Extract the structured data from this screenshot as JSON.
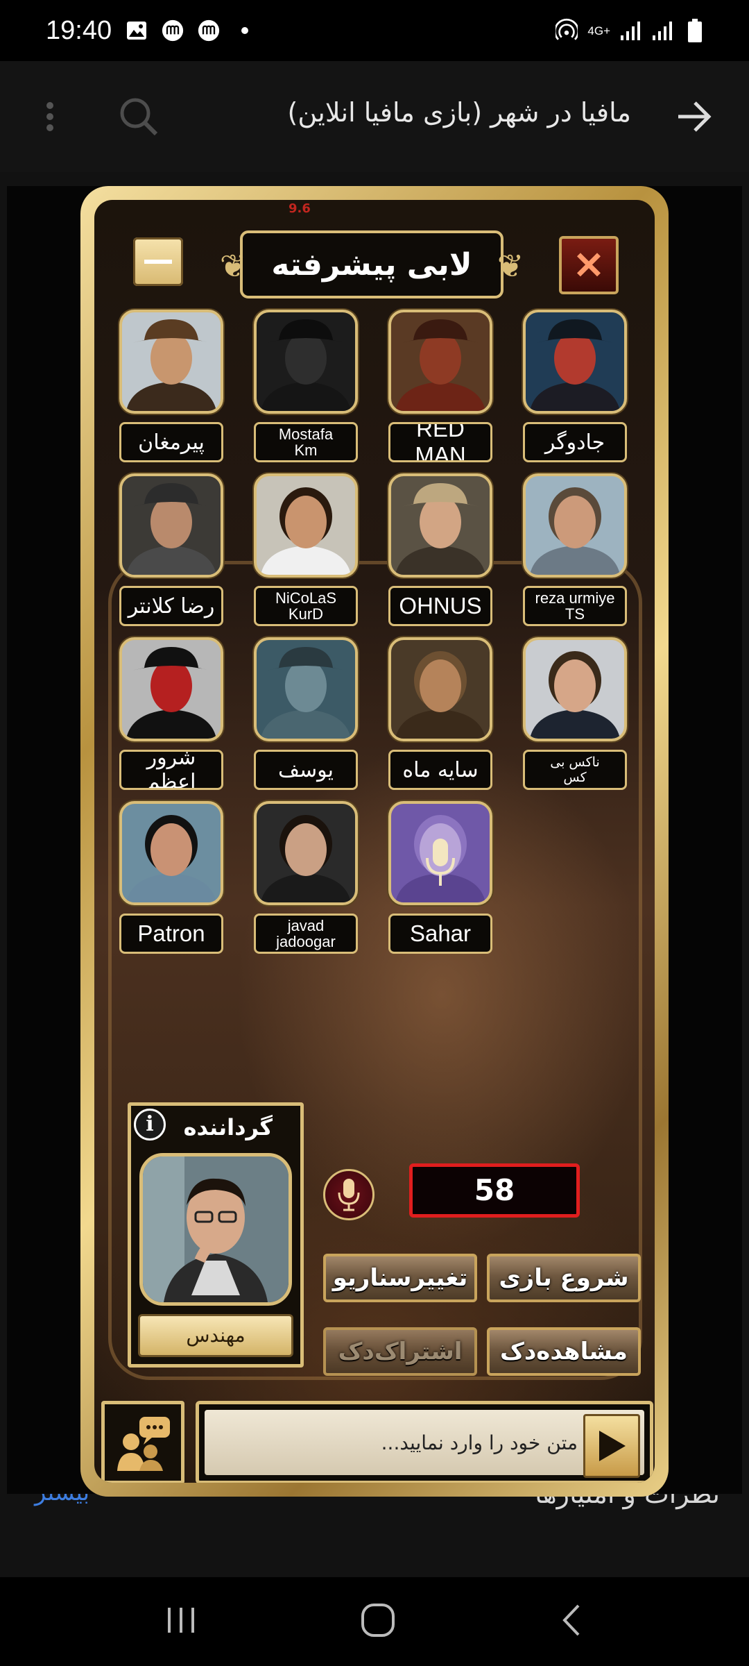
{
  "status_bar": {
    "time": "19:40",
    "network": "4G+",
    "icons": [
      "gallery-icon",
      "app-icon",
      "app-icon",
      "dot-icon",
      "hotspot-icon",
      "signal-icon",
      "signal-icon",
      "battery-icon"
    ]
  },
  "appbar": {
    "title": "مافیا در شهر (بازی مافیا انلاین)"
  },
  "page_peek": {
    "ratings_label": "نظرات و امتیازها",
    "more_label": "بیشتر"
  },
  "lobby": {
    "version": "9.6",
    "title": "لابی پیشرفته",
    "players": [
      {
        "name": "پیرمغان",
        "style": "fa"
      },
      {
        "name": "Mostafa\nKm",
        "style": "small"
      },
      {
        "name": "RED MAN",
        "style": "big"
      },
      {
        "name": "جادوگر",
        "style": "fa"
      },
      {
        "name": "رضا کلانتر",
        "style": "fa"
      },
      {
        "name": "NiCoLaS\nKurD",
        "style": "small"
      },
      {
        "name": "OHNUS",
        "style": "big"
      },
      {
        "name": "reza urmiye\nTS",
        "style": "small"
      },
      {
        "name": "شرور اعظم",
        "style": "fa"
      },
      {
        "name": "یوسف",
        "style": "fa"
      },
      {
        "name": "سایه ماه",
        "style": "fa"
      },
      {
        "name": "ناکس بی\nکس",
        "style": "smallfa"
      },
      {
        "name": "Patron",
        "style": "big"
      },
      {
        "name": "javad\njadoogar",
        "style": "small"
      },
      {
        "name": "Sahar",
        "style": "big"
      }
    ],
    "host": {
      "label": "گرداننده",
      "info_glyph": "i",
      "name": "مهندس"
    },
    "counter": "58",
    "buttons": {
      "start_game": "شروع بازی",
      "change_scenario": "تغییرسناریو",
      "view_deck": "مشاهده‌دک",
      "share_deck": "اشتراک‌دک"
    },
    "chat": {
      "placeholder": "متن خود را وارد نمایید..."
    }
  },
  "colors": {
    "gold": "#d9bd78",
    "counter_border": "#e01e1e",
    "link_blue": "#3d7de0"
  }
}
